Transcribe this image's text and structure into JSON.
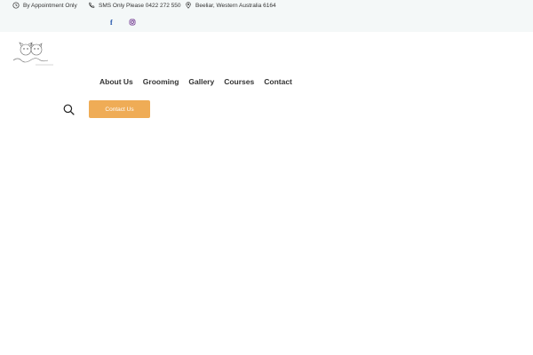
{
  "topbar": {
    "items": [
      {
        "icon": "clock-icon",
        "text": "By Appointment Only"
      },
      {
        "icon": "phone-icon",
        "text": "SMS Only Please 0422 272 550"
      },
      {
        "icon": "location-pin-icon",
        "text": "Beeliar, Western Australia 6164"
      }
    ],
    "social": [
      {
        "icon": "facebook-icon",
        "glyph": "f"
      },
      {
        "icon": "instagram-icon"
      }
    ]
  },
  "logo": {
    "icon": "dog-cat-logo-icon"
  },
  "nav": {
    "items": [
      "About Us",
      "Grooming",
      "Gallery",
      "Courses",
      "Contact"
    ]
  },
  "header": {
    "search_icon": "search-icon",
    "contact_label": "Contact Us"
  },
  "colors": {
    "topbar_bg": "#f4f8f8",
    "accent": "#efac56",
    "facebook": "#1b4fa8",
    "instagram": "#6b2f8c"
  }
}
